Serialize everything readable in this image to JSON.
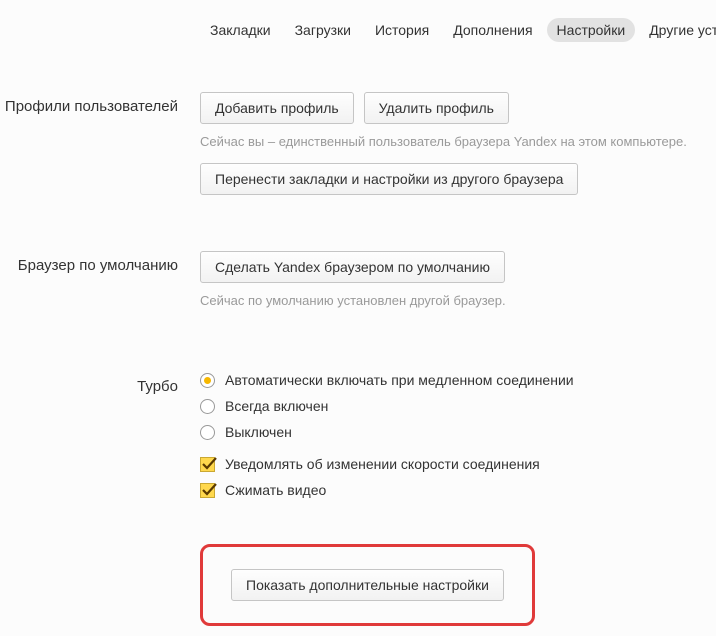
{
  "tabs": {
    "bookmarks": "Закладки",
    "downloads": "Загрузки",
    "history": "История",
    "addons": "Дополнения",
    "settings": "Настройки",
    "other_devices": "Другие устр"
  },
  "profiles": {
    "label": "Профили пользователей",
    "add_btn": "Добавить профиль",
    "delete_btn": "Удалить профиль",
    "hint": "Сейчас вы – единственный пользователь браузера Yandex на этом компьютере.",
    "import_btn": "Перенести закладки и настройки из другого браузера"
  },
  "default_browser": {
    "label": "Браузер по умолчанию",
    "set_btn": "Сделать Yandex браузером по умолчанию",
    "hint": "Сейчас по умолчанию установлен другой браузер."
  },
  "turbo": {
    "label": "Турбо",
    "radio_auto": "Автоматически включать при медленном соединении",
    "radio_always": "Всегда включен",
    "radio_off": "Выключен",
    "check_notify": "Уведомлять об изменении скорости соединения",
    "check_compress": "Сжимать видео"
  },
  "show_more_btn": "Показать дополнительные настройки"
}
